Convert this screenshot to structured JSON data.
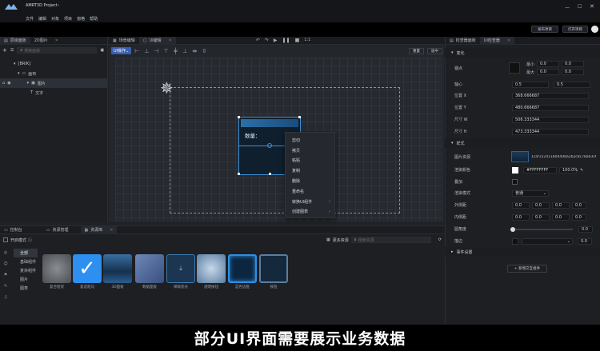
{
  "titlebar": {
    "project": "AMRT3D Project",
    "publish": "发布项目",
    "open": "打开项目"
  },
  "menu": [
    "文件",
    "编辑",
    "对象",
    "项目",
    "窗格",
    "帮助"
  ],
  "left_panel": {
    "tabs": [
      "层级面板",
      "2D图片"
    ],
    "search_placeholder": "搜索面板",
    "tree": [
      "[BRIK]",
      "画布",
      "图片",
      "文字"
    ]
  },
  "editor": {
    "tabs": [
      "场景编辑",
      "UI编辑"
    ],
    "ui_tool": "UI操作",
    "zoom": "1:1",
    "btn_a": "重置",
    "btn_b": "居中"
  },
  "widget": {
    "label": "数量："
  },
  "context_menu": [
    "剪切",
    "拷贝",
    "粘贴",
    "复制",
    "删除",
    "重命名",
    "转换UI组件",
    "创建图表"
  ],
  "right_panel": {
    "tabs": [
      "检查器面板",
      "UI检查器"
    ],
    "transform": "变化",
    "anchor_label": "锚点",
    "anchor_min": "最小",
    "anchor_max": "最大",
    "zero": "0.0",
    "one": "0.0",
    "pivot_label": "轴心",
    "pivot_x": "0.5",
    "pivot_y": "0.5",
    "rows": [
      {
        "label": "位置 X",
        "value": "368.666687"
      },
      {
        "label": "位置 Y",
        "value": "480.666687"
      },
      {
        "label": "尺寸 W",
        "value": "506.333344"
      },
      {
        "label": "尺寸 H",
        "value": "473.333344"
      }
    ],
    "style": "样式",
    "image_label": "图片资源",
    "image_value": "1caf152411b04408a2b2c8c78a03c62",
    "tint_label": "渲染颜色",
    "tint_hex": "#FFFFFFFF",
    "tint_pct": "100.0%",
    "overlay_label": "叠加",
    "render_mode_label": "渲染模式",
    "render_mode_value": "普通",
    "outer_label": "外侧距",
    "inner_label": "内侧距",
    "rounded_label": "圆角度",
    "rounded_value": "0.0",
    "border_label": "描边",
    "border_value": "0.0",
    "events": "事件设置",
    "add_event": "+ 新增交互组件"
  },
  "bottom": {
    "tabs": [
      "控制台",
      "资源管理",
      "资源库"
    ],
    "layout_mode": "开启模式",
    "more": "更多资源",
    "search_placeholder": "搜索资源",
    "categories": [
      "全部",
      "基础组件",
      "复杂组件",
      "图片",
      "图表"
    ],
    "assets": [
      "复合框架",
      "复选框勾",
      "3D面板",
      "数据面板",
      "梯级底光",
      "透明按钮",
      "蓝色边框",
      "按钮"
    ]
  },
  "subtitle": "部分UI界面需要展示业务数据"
}
